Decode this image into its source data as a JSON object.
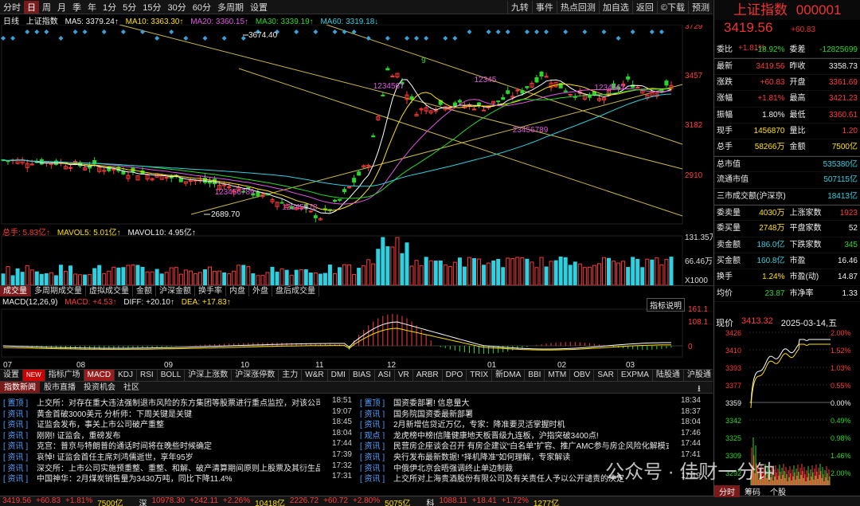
{
  "toolbar": {
    "periods": [
      "分时",
      "日",
      "周",
      "月",
      "季",
      "年",
      "1分",
      "5分",
      "15分",
      "30分",
      "60分",
      "多周期",
      "设置"
    ],
    "selected": 1,
    "right_items": [
      "九转",
      "事件",
      "热点回测",
      "加自选",
      "返回",
      "©下载",
      "预测"
    ]
  },
  "chart_title": "日线",
  "ma_legend": {
    "index": "上证指数",
    "ma5": "MA5: 3379.24↑",
    "ma10": "MA10: 3363.30↑",
    "ma20": "MA20: 3360.15↑",
    "ma30": "MA30: 3339.19↑",
    "ma60": "MA60: 3319.18↓"
  },
  "price_axis": [
    "3729",
    "3457",
    "3182",
    "2910"
  ],
  "annotations": {
    "high": "3674.40",
    "low": "2689.70"
  },
  "nine_turn": {
    "down1": "12345678",
    "down2": "123456789",
    "up1": "1234567",
    "nine_top": "9",
    "up2": "12345",
    "down3": "23456789",
    "up3": "1234567"
  },
  "volume_legend": {
    "total": "总手: 5.83亿↑",
    "mavol5": "MAVOL5: 5.01亿↑",
    "mavol10": "MAVOL10: 4.95亿↑"
  },
  "volume_axis": [
    "131.35万",
    "66.46万",
    "X1000"
  ],
  "volume_tabs": [
    "成交量",
    "多周期成交量",
    "虚拟成交量",
    "金额",
    "沪深金额",
    "换手率",
    "内盘",
    "外盘",
    "盘后成交量"
  ],
  "macd_legend": {
    "name": "MACD(12,26,9)",
    "macd": "MACD: +4.53↑",
    "diff": "DIFF: +20.10↑",
    "dea": "DEA: +17.83↑",
    "button": "指标说明"
  },
  "macd_axis": [
    "161.1",
    "108.1",
    "0"
  ],
  "date_axis": [
    "07",
    "08",
    "09",
    "10",
    "11",
    "12",
    "01",
    "02",
    "03"
  ],
  "indicator_tabs": [
    "设置",
    "NEW",
    "指标广场",
    "MACD",
    "KDJ",
    "RSI",
    "BOLL",
    "沪深上涨数",
    "沪深涨停数",
    "主力",
    "W&R",
    "DMI",
    "BIAS",
    "ASI",
    "VR",
    "ARBR",
    "DPO",
    "TRIX",
    "新DMA",
    "BBI",
    "MTM",
    "OBV",
    "SAR",
    "EXPMA",
    "陆股通",
    "沪股通",
    "深"
  ],
  "news_tabs": [
    "指数新闻",
    "股市直播",
    "投资机会",
    "社区"
  ],
  "news_left": [
    {
      "tag": "[ 置顶 ]",
      "title": "上交所：对存在重大违法强制退市风险的东方集团等股票进行重点监控，对该公司...",
      "time": "18:51"
    },
    {
      "tag": "[ 资讯 ]",
      "title": "黄金首破3000美元 分析师：下周关键是关键",
      "time": "19:07"
    },
    {
      "tag": "[ 资讯 ]",
      "title": "证监会发布，事关上市公司破产重整",
      "time": "18:45"
    },
    {
      "tag": "[ 资讯 ]",
      "title": "刚刚! 证监会，重磅发布",
      "time": "18:04"
    },
    {
      "tag": "[ 资讯 ]",
      "title": "克宫：普京与特朗普的通话时间将在晚些时候确定",
      "time": "17:44"
    },
    {
      "tag": "[ 资讯 ]",
      "title": "哀悼! 证监会首任主席刘鸿儒逝世，享年95岁",
      "time": "17:39"
    },
    {
      "tag": "[ 资讯 ]",
      "title": "深交所：上市公司实施预重整、重整、和解、破产清算期间原则上股票及其衍生品...",
      "time": "17:32"
    },
    {
      "tag": "[ 资讯 ]",
      "title": "中国神华：2月煤炭销售量为3430万吨，同比下降11.4%",
      "time": "17:31"
    }
  ],
  "news_right": [
    {
      "tag": "[ 置顶 ]",
      "title": "国资委部署! 信息量大",
      "time": "18:34"
    },
    {
      "tag": "[ 资讯 ]",
      "title": "国务院国资委最新部署",
      "time": "18:37"
    },
    {
      "tag": "[ 资讯 ]",
      "title": "2月新增信贷近万亿，专家：降准要灵活掌握时机",
      "time": "18:04"
    },
    {
      "tag": "[ 观点 ]",
      "title": "龙虎榜中榜|信隆健康地天板晋级九连板，沪指突破3400点!",
      "time": "17:46"
    },
    {
      "tag": "[ 资讯 ]",
      "title": "民营房企座谈会召开 有房企建议“白名单”扩容、推广AMC参与房企风险化解模式",
      "time": "17:44"
    },
    {
      "tag": "[ 资讯 ]",
      "title": "央行发布最新数据! “择机降准”如何理解，专家解读",
      "time": "17:41"
    },
    {
      "tag": "[ 资讯 ]",
      "title": "中俄伊北京会晤强调终止单边制裁",
      "time": ""
    },
    {
      "tag": "[ 资讯 ]",
      "title": "上交所对上海贵酒股份有限公司及有关责任人予以公开谴责的决定",
      "time": "17:19"
    }
  ],
  "status_bar": [
    "3419.56",
    "+60.83",
    "+1.81%",
    "7500亿",
    "深",
    "10978.30",
    "+242.11",
    "+2.26%",
    "10418亿",
    "2226.72",
    "+60.72",
    "+2.80%",
    "5075亿",
    "科",
    "1088.11",
    "+18.41",
    "+1.72%",
    "1277亿"
  ],
  "quote": {
    "name": "上证指数",
    "code": "000001",
    "price": "3419.56",
    "change": "+60.83",
    "pct": "+1.81%"
  },
  "quote_rows": [
    [
      [
        "委比",
        "-18.92%",
        "green"
      ],
      [
        "委差",
        "-12825699",
        "green"
      ]
    ],
    [
      [
        "最新",
        "3419.56",
        "red"
      ],
      [
        "昨收",
        "3358.73",
        "white"
      ]
    ],
    [
      [
        "涨跌",
        "+60.83",
        "red"
      ],
      [
        "开盘",
        "3361.69",
        "red"
      ]
    ],
    [
      [
        "涨幅",
        "+1.81%",
        "red"
      ],
      [
        "最高",
        "3421.23",
        "red"
      ]
    ],
    [
      [
        "振幅",
        "1.80%",
        "white"
      ],
      [
        "最低",
        "3360.61",
        "red"
      ]
    ],
    [
      [
        "现手",
        "1456870",
        "yellow"
      ],
      [
        "量比",
        "1.20",
        "red"
      ]
    ],
    [
      [
        "总手",
        "58266万",
        "yellow"
      ],
      [
        "金额",
        "7500亿",
        "yellow"
      ]
    ],
    [
      [
        "总市值",
        "535380亿",
        "cyan"
      ],
      [
        "",
        "",
        ""
      ]
    ],
    [
      [
        "流通市值",
        "507115亿",
        "cyan"
      ],
      [
        "",
        "",
        ""
      ]
    ],
    [
      [
        "三市成交额(沪深京)",
        "18413亿",
        "cyan"
      ],
      [
        "",
        "",
        ""
      ]
    ],
    [
      [
        "委卖量",
        "4030万",
        "yellow"
      ],
      [
        "上涨家数",
        "1923",
        "red"
      ]
    ],
    [
      [
        "委买量",
        "2748万",
        "yellow"
      ],
      [
        "平盘家数",
        "52",
        "white"
      ]
    ],
    [
      [
        "卖金额",
        "186.0亿",
        "cyan"
      ],
      [
        "下跌家数",
        "345",
        "green"
      ]
    ],
    [
      [
        "买金额",
        "160.8亿",
        "cyan"
      ],
      [
        "市盈",
        "16.46",
        "white"
      ]
    ],
    [
      [
        "换手",
        "1.24%",
        "yellow"
      ],
      [
        "市盈(动)",
        "14.87",
        "white"
      ]
    ],
    [
      [
        "均价",
        "23.87",
        "green"
      ],
      [
        "市净率",
        "1.33",
        "white"
      ]
    ]
  ],
  "mini_chart": {
    "label": "现价",
    "price": "3413.32",
    "date": "2025-03-14,五",
    "left_axis": [
      "3426",
      "3410",
      "3393",
      "3377",
      "3359",
      "3342",
      "3325",
      "3309",
      "3292"
    ],
    "right_axis": [
      "2.00%",
      "1.52%",
      "1.03%",
      "0.55%",
      "0.00%",
      "0.49%",
      "0.98%",
      "1.46%",
      "2.00%"
    ],
    "tabs": [
      "分时",
      "筹码",
      "个股"
    ]
  },
  "watermark": "公众号 · 佳财一分钟"
}
